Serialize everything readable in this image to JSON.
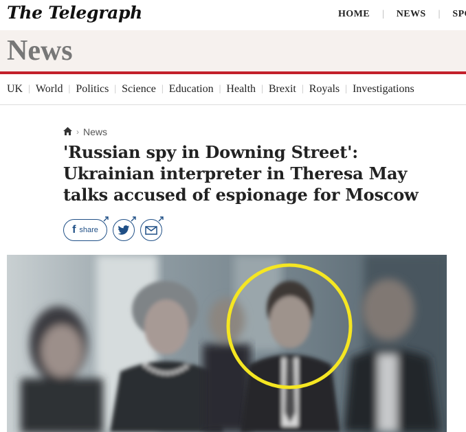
{
  "masthead": {
    "logo": "The Telegraph",
    "nav": [
      "HOME",
      "NEWS",
      "SPO"
    ]
  },
  "section": {
    "title": "News"
  },
  "subnav": [
    "UK",
    "World",
    "Politics",
    "Science",
    "Education",
    "Health",
    "Brexit",
    "Royals",
    "Investigations"
  ],
  "breadcrumb": {
    "home_icon": "home-icon",
    "section": "News"
  },
  "article": {
    "headline_lines": [
      "'Russian spy in Downing Street':",
      "Ukrainian interpreter in Theresa May",
      "talks accused of espionage for Moscow"
    ]
  },
  "share": {
    "facebook_label": "share",
    "icons": [
      "facebook-icon",
      "twitter-icon",
      "email-icon"
    ]
  },
  "colors": {
    "accent_red": "#c3202b",
    "share_blue": "#1f4f86",
    "section_bg": "#f6f1ee",
    "highlight_circle": "#f5e622"
  }
}
